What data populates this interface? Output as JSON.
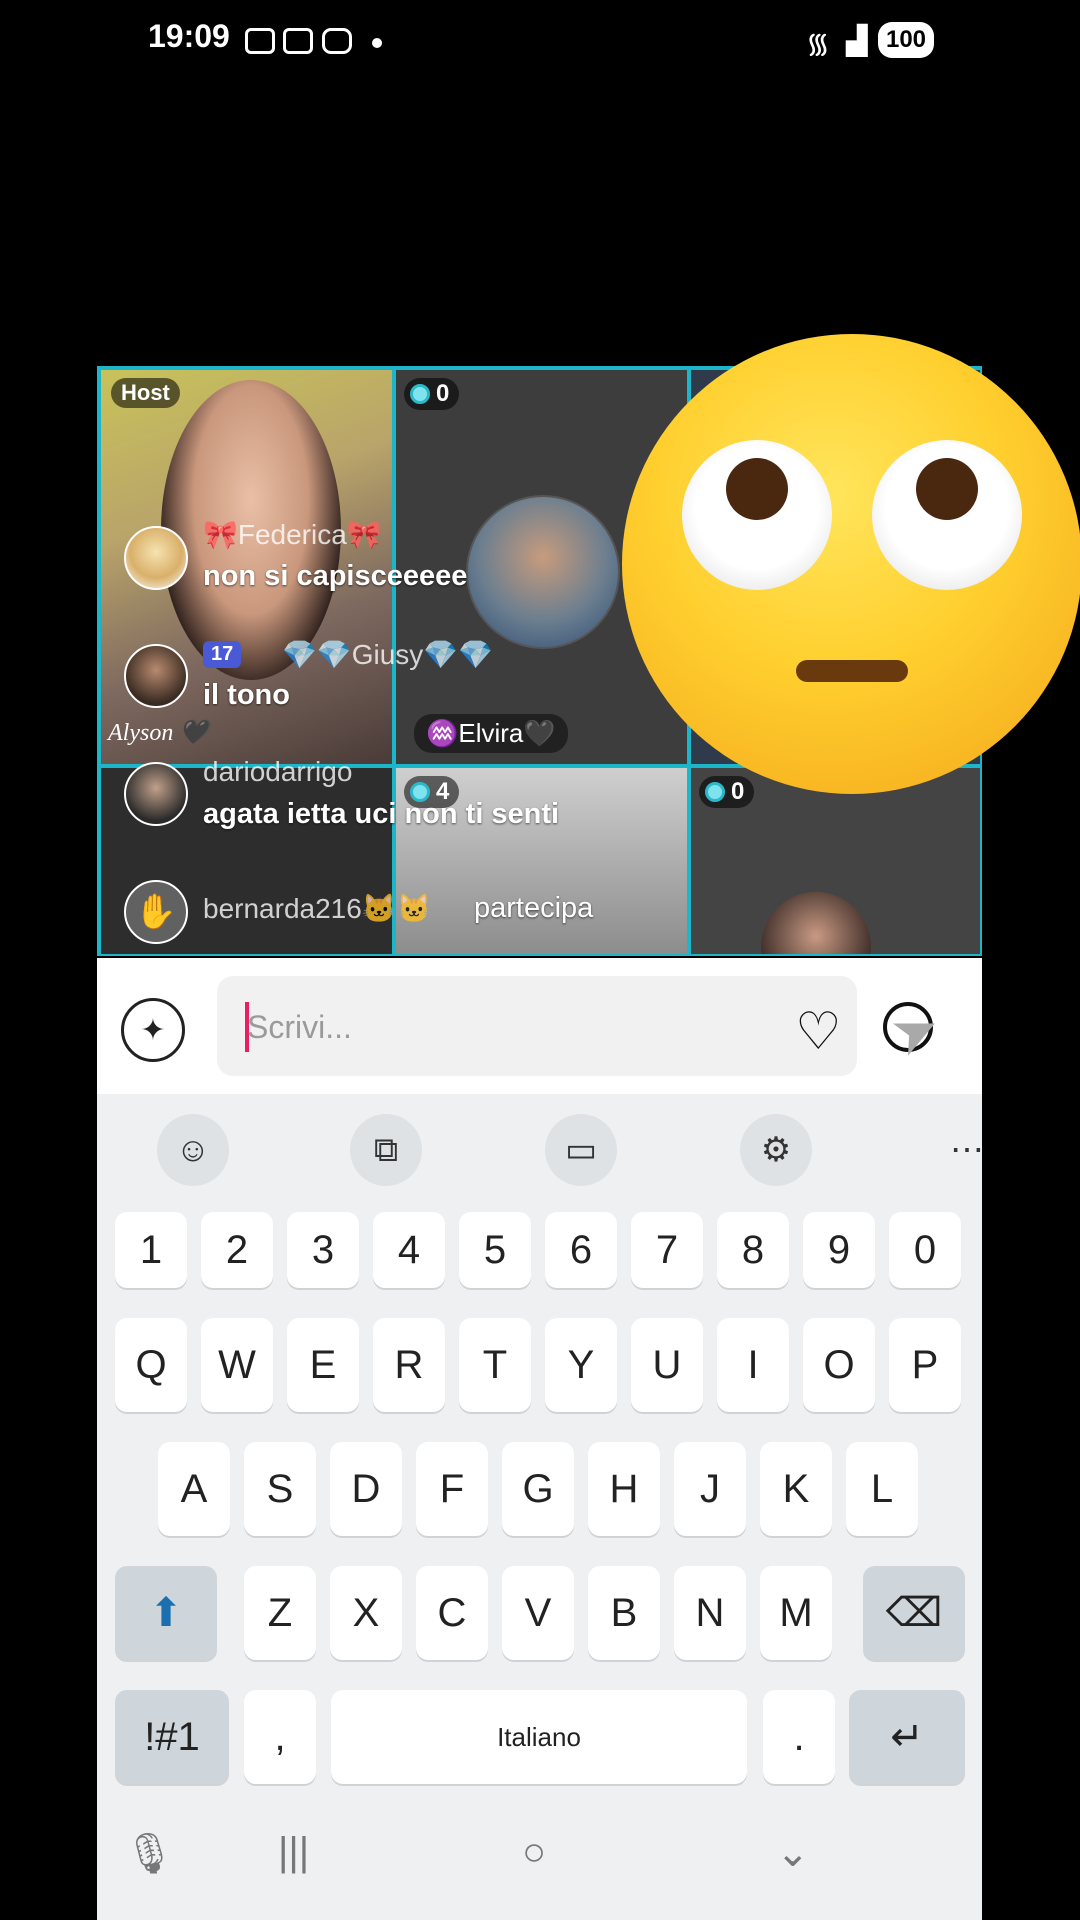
{
  "status_bar": {
    "time": "19:09",
    "battery": "100"
  },
  "live": {
    "host_badge": "Host",
    "tile_counts": [
      "0",
      "4",
      "0"
    ],
    "chat": [
      {
        "name": "🎀Federica🎀",
        "message": "non si capisceeeee"
      },
      {
        "level": "17",
        "name": "💎💎Giusy💎💎",
        "message": "il tono",
        "tag": "Alyson 🖤"
      },
      {
        "name": "dariodarrigo",
        "message": "agata ietta uci non ti senti"
      },
      {
        "name": "bernarda216🐱🐱",
        "message": "partecipa"
      }
    ],
    "participant_tag": "♒Elvira🖤"
  },
  "composer": {
    "placeholder": "Scrivi...",
    "ai_icon": "sparkle-icon",
    "heart_icon": "heart-icon",
    "emoji_icon": "emoji-icon",
    "send_icon": "send-icon"
  },
  "keyboard": {
    "toolbar": [
      "emoji-icon",
      "translate-icon",
      "clipboard-icon",
      "settings-icon",
      "more-icon"
    ],
    "toolbar_glyphs": [
      "☺",
      "⧉",
      "▭",
      "⚙",
      "⋯"
    ],
    "row_numbers": [
      "1",
      "2",
      "3",
      "4",
      "5",
      "6",
      "7",
      "8",
      "9",
      "0"
    ],
    "row_1": [
      "Q",
      "W",
      "E",
      "R",
      "T",
      "Y",
      "U",
      "I",
      "O",
      "P"
    ],
    "row_2": [
      "A",
      "S",
      "D",
      "F",
      "G",
      "H",
      "J",
      "K",
      "L"
    ],
    "row_3": [
      "Z",
      "X",
      "C",
      "V",
      "B",
      "N",
      "M"
    ],
    "symbols_key": "!#1",
    "comma_key": ",",
    "space_label": "Italiano",
    "period_key": ".",
    "enter_glyph": "↵",
    "shift_glyph": "⬆",
    "backspace_glyph": "⌫"
  },
  "nav_bar": {
    "mic": "🎙",
    "recents": "|||",
    "home": "○",
    "back": "⌄"
  }
}
